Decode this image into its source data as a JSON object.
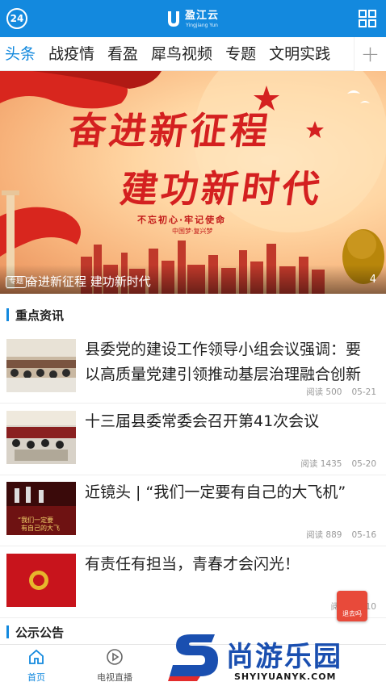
{
  "header": {
    "channel_badge": "24",
    "logo_cn": "盈江云",
    "logo_en": "Yingjiang Yun"
  },
  "tabs": [
    {
      "label": "头条",
      "active": true
    },
    {
      "label": "战疫情"
    },
    {
      "label": "看盈"
    },
    {
      "label": "犀鸟视频"
    },
    {
      "label": "专题"
    },
    {
      "label": "文明实践"
    }
  ],
  "tabs_add_icon": "plus-icon",
  "banner": {
    "headline_line1": "奋进新征程",
    "headline_line2": "建功新时代",
    "slogan": "不忘初心·牢记使命",
    "sub_slogan": "中国梦·复兴梦",
    "tag": "专题",
    "caption": "奋进新征程 建功新时代",
    "page_indicator": "4"
  },
  "sections": {
    "key_news": "重点资讯",
    "announcements": "公示公告"
  },
  "news": [
    {
      "title": "县委党的建设工作领导小组会议强调：要以高质量党建引领推动基层治理融合创新",
      "reads": "阅读 500",
      "date": "05-21"
    },
    {
      "title": "十三届县委常委会召开第41次会议",
      "reads": "阅读 1435",
      "date": "05-20"
    },
    {
      "title": "近镜头 | “我们一定要有自己的大飞机”",
      "reads": "阅读 889",
      "date": "05-16"
    },
    {
      "title": "有责任有担当，青春才会闪光！",
      "reads": "阅读 5",
      "date": "10"
    }
  ],
  "float_badge": "退去吗",
  "bottom_nav": [
    {
      "label": "首页",
      "icon": "home-icon",
      "active": true
    },
    {
      "label": "电视直播",
      "icon": "play-icon"
    }
  ],
  "watermark": {
    "cn": "尚游乐园",
    "en": "SHYIYUANYK.COM"
  },
  "colors": {
    "brand_blue": "#1389de",
    "banner_red": "#d42020",
    "muted_text": "#999999"
  }
}
